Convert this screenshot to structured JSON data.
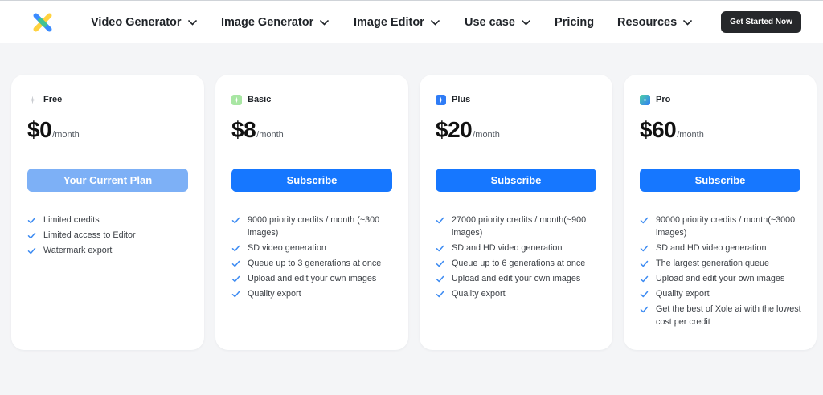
{
  "nav": {
    "items": [
      {
        "label": "Video Generator",
        "has_dropdown": true
      },
      {
        "label": "Image Generator",
        "has_dropdown": true
      },
      {
        "label": "Image Editor",
        "has_dropdown": true
      },
      {
        "label": "Use case",
        "has_dropdown": true
      },
      {
        "label": "Pricing",
        "has_dropdown": false
      },
      {
        "label": "Resources",
        "has_dropdown": true
      }
    ],
    "cta_label": "Get Started Now"
  },
  "colors": {
    "accent": "#1677ff",
    "current_plan": "#7db0f6",
    "check": "#3d8bf2",
    "cta": "#26282b"
  },
  "plans": [
    {
      "name": "Free",
      "icon": "sparkle-outline-icon",
      "price": "$0",
      "period": "/month",
      "button": "Your Current Plan",
      "features": [
        "Limited credits",
        "Limited access to Editor",
        "Watermark export"
      ]
    },
    {
      "name": "Basic",
      "icon": "sparkle-green-icon",
      "price": "$8",
      "period": "/month",
      "button": "Subscribe",
      "features": [
        "9000 priority credits / month (~300 images)",
        "SD video generation",
        "Queue up to 3 generations at once",
        "Upload and edit your own images",
        "Quality export"
      ]
    },
    {
      "name": "Plus",
      "icon": "sparkle-blue-icon",
      "price": "$20",
      "period": "/month",
      "button": "Subscribe",
      "features": [
        "27000 priority credits / month(~900 images)",
        "SD and HD video generation",
        "Queue up to 6 generations at once",
        "Upload and edit your own images",
        "Quality export"
      ]
    },
    {
      "name": "Pro",
      "icon": "sparkle-gradient-icon",
      "price": "$60",
      "period": "/month",
      "button": "Subscribe",
      "features": [
        "90000 priority credits / month(~3000 images)",
        "SD and HD video generation",
        "The largest generation queue",
        "Upload and edit your own images",
        "Quality export",
        "Get the best of Xole ai with the lowest cost per credit"
      ]
    }
  ]
}
